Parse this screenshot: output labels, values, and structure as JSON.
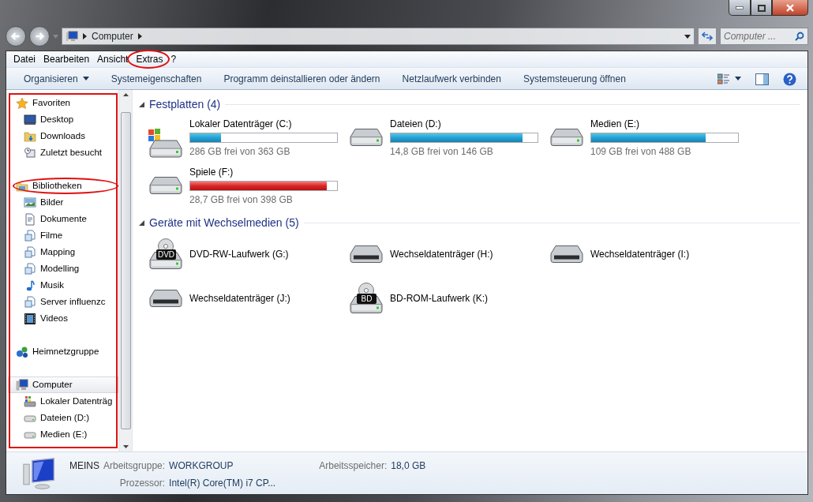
{
  "address": {
    "crumb": "Computer",
    "search_placeholder": "Computer ..."
  },
  "menu": [
    {
      "label": "Datei",
      "highlighted": false
    },
    {
      "label": "Bearbeiten",
      "highlighted": false
    },
    {
      "label": "Ansicht",
      "highlighted": false
    },
    {
      "label": "Extras",
      "highlighted": true
    },
    {
      "label": "?",
      "highlighted": false
    }
  ],
  "toolbar": [
    {
      "label": "Organisieren",
      "dropdown": true
    },
    {
      "label": "Systemeigenschaften",
      "dropdown": false
    },
    {
      "label": "Programm deinstallieren oder ändern",
      "dropdown": false
    },
    {
      "label": "Netzlaufwerk verbinden",
      "dropdown": false
    },
    {
      "label": "Systemsteuerung öffnen",
      "dropdown": false
    }
  ],
  "nav": {
    "highlighted": true,
    "groups": [
      {
        "label": "Favoriten",
        "highlighted": false,
        "selected": false,
        "children": [
          {
            "label": "Desktop"
          },
          {
            "label": "Downloads"
          },
          {
            "label": "Zuletzt besucht"
          }
        ]
      },
      {
        "label": "Bibliotheken",
        "highlighted": true,
        "selected": false,
        "children": [
          {
            "label": "Bilder"
          },
          {
            "label": "Dokumente"
          },
          {
            "label": "Filme"
          },
          {
            "label": "Mapping"
          },
          {
            "label": "Modelling"
          },
          {
            "label": "Musik"
          },
          {
            "label": "Server influenzc"
          },
          {
            "label": "Videos"
          }
        ]
      },
      {
        "label": "Heimnetzgruppe",
        "highlighted": false,
        "selected": false
      },
      {
        "label": "Computer",
        "highlighted": false,
        "selected": true,
        "children": [
          {
            "label": "Lokaler Datenträg"
          },
          {
            "label": "Dateien (D:)"
          },
          {
            "label": "Medien (E:)"
          }
        ]
      }
    ]
  },
  "sections": [
    {
      "title": "Festplatten (4)",
      "items": [
        {
          "name": "Lokaler Datenträger (C:)",
          "kind": "system",
          "level": 0.21,
          "warning": false,
          "free": "286 GB frei von 363 GB"
        },
        {
          "name": "Dateien (D:)",
          "kind": "disk",
          "level": 0.9,
          "warning": false,
          "free": "14,8 GB frei von 146 GB"
        },
        {
          "name": "Medien (E:)",
          "kind": "disk",
          "level": 0.78,
          "warning": false,
          "free": "109 GB frei von 488 GB"
        },
        {
          "name": "Spiele (F:)",
          "kind": "disk",
          "level": 0.93,
          "warning": true,
          "free": "28,7 GB frei von 398 GB"
        }
      ]
    },
    {
      "title": "Geräte mit Wechselmedien (5)",
      "items": [
        {
          "name": "DVD-RW-Laufwerk (G:)",
          "kind": "optical",
          "badge": "DVD"
        },
        {
          "name": "Wechseldatenträger (H:)",
          "kind": "removable"
        },
        {
          "name": "Wechseldatenträger (I:)",
          "kind": "removable"
        },
        {
          "name": "Wechseldatenträger (J:)",
          "kind": "removable"
        },
        {
          "name": "BD-ROM-Laufwerk (K:)",
          "kind": "optical",
          "badge": "BD"
        }
      ]
    }
  ],
  "status": {
    "computer": "MEINS",
    "rows": [
      [
        {
          "label": "Arbeitsgruppe:",
          "value": "WORKGROUP"
        },
        {
          "label": "Arbeitsspeicher:",
          "value": "18,0 GB"
        }
      ],
      [
        {
          "label": "Prozessor:",
          "value": "Intel(R) Core(TM) i7 CP..."
        }
      ]
    ]
  }
}
